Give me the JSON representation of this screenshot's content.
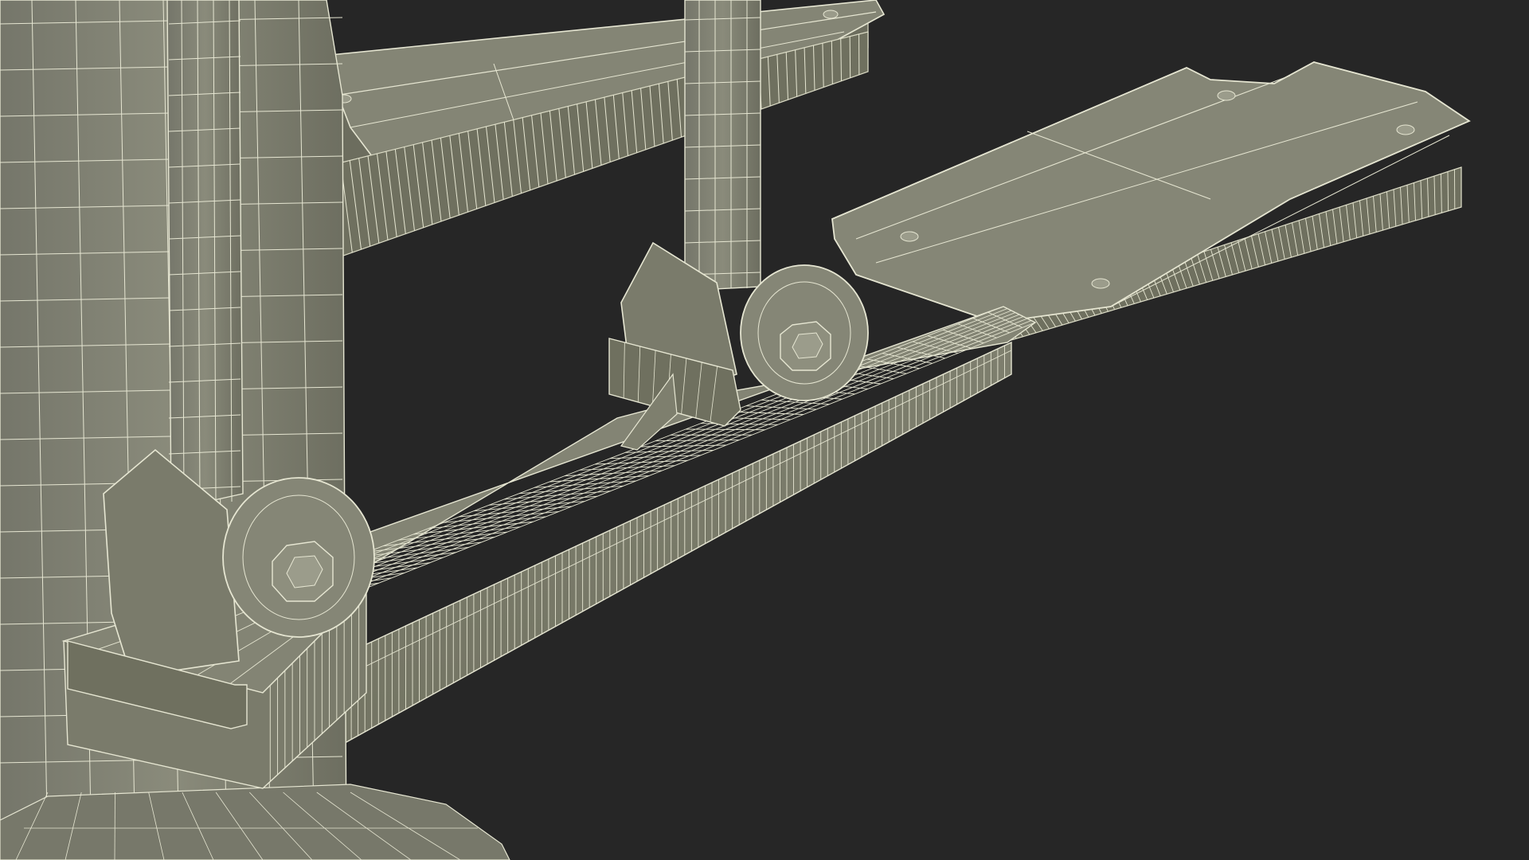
{
  "scene": {
    "background_color": "#262626",
    "surface_color": "#7d7e6d",
    "surface_light": "#8b8c7a",
    "surface_dark": "#6a6b5c",
    "wire_color": "#e6e6d2"
  }
}
